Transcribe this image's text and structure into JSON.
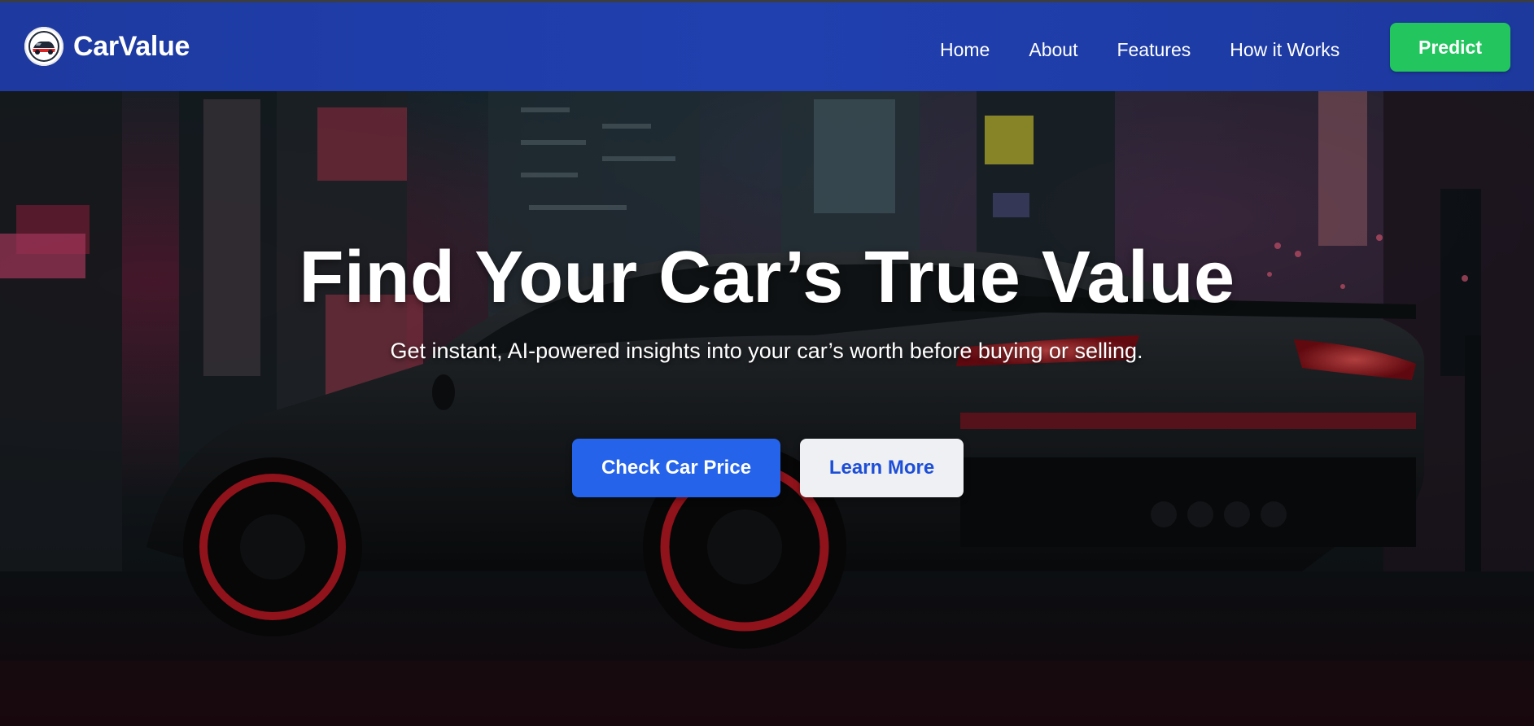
{
  "brand": {
    "name": "CarValue",
    "logo_icon": "car-logo-icon"
  },
  "nav": {
    "items": [
      "Home",
      "About",
      "Features",
      "How it Works"
    ],
    "predict_label": "Predict"
  },
  "hero": {
    "title": "Find Your Car’s True Value",
    "subtitle": "Get instant, AI-powered insights into your car’s worth before buying or selling.",
    "primary_cta": "Check Car Price",
    "secondary_cta": "Learn More",
    "background_icon": "sports-car-city-night-image"
  },
  "colors": {
    "header": "#1e3aa0",
    "predict": "#22c55e",
    "primary_cta": "#2563eb",
    "secondary_cta_bg": "#eef0f3",
    "secondary_cta_text": "#1d4ed8"
  }
}
